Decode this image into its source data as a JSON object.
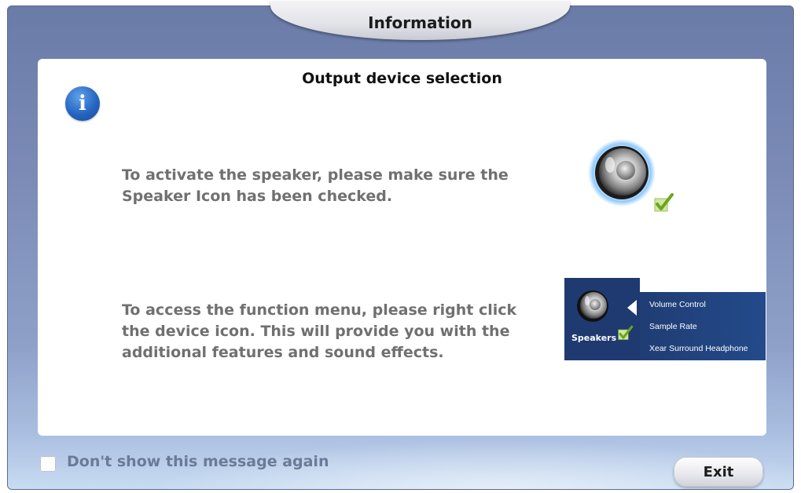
{
  "window": {
    "title": "Information"
  },
  "panel": {
    "heading": "Output device selection",
    "info_icon": "info-icon",
    "paragraph1": "To activate the speaker, please make sure the\nSpeaker Icon has been checked.",
    "paragraph2": "To access the function menu, please right click\nthe device icon. This will provide you with the\nadditional features and sound effects."
  },
  "illustration": {
    "speaker_icon": "speaker-icon",
    "check_icon": "checkmark-icon",
    "device_label": "Speakers",
    "menu_items": [
      "Volume Control",
      "Sample Rate",
      "Xear Surround Headphone"
    ]
  },
  "footer": {
    "dont_show_label": "Don't show this message again",
    "exit_label": "Exit"
  },
  "colors": {
    "accent": "#2566c2",
    "menu_bg": "#1f3a70",
    "check_green": "#7bbf2e"
  }
}
